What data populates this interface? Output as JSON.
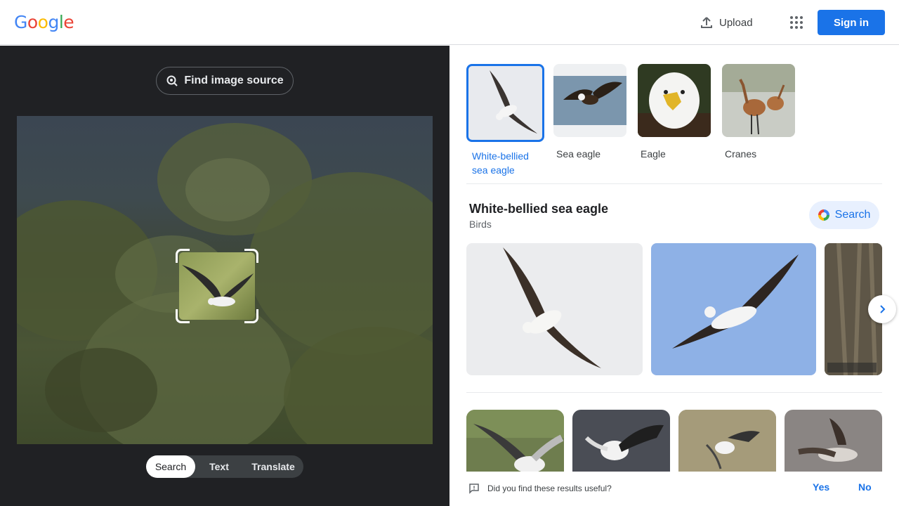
{
  "header": {
    "logo": [
      "G",
      "o",
      "o",
      "g",
      "l",
      "e"
    ],
    "logo_colors": [
      "#4285f4",
      "#ea4335",
      "#fbbc05",
      "#4285f4",
      "#34a853",
      "#ea4335"
    ],
    "upload_label": "Upload",
    "signin_label": "Sign in"
  },
  "left_pane": {
    "find_source_label": "Find image source",
    "tabs": [
      "Search",
      "Text",
      "Translate"
    ],
    "active_tab": "Search"
  },
  "right_pane": {
    "related_chips": [
      {
        "label": "White-bellied sea eagle",
        "selected": true
      },
      {
        "label": "Sea eagle",
        "selected": false
      },
      {
        "label": "Eagle",
        "selected": false
      },
      {
        "label": "Cranes",
        "selected": false
      }
    ],
    "entity": {
      "title": "White-bellied sea eagle",
      "subtitle": "Birds",
      "search_label": "Search"
    },
    "feedback": {
      "question": "Did you find these results useful?",
      "yes": "Yes",
      "no": "No"
    }
  },
  "colors": {
    "accent": "#1a73e8",
    "dark_pane": "#202124"
  }
}
